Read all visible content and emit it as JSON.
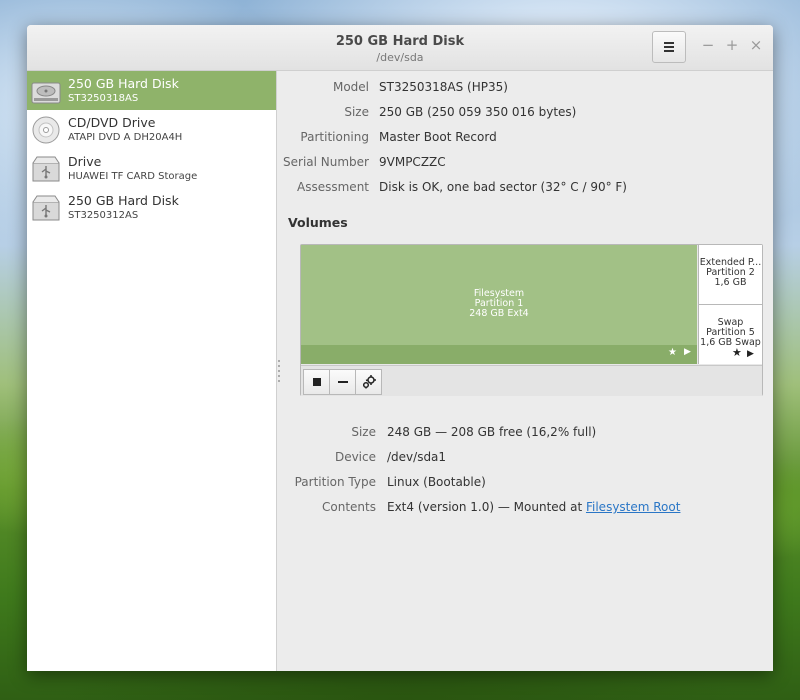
{
  "window": {
    "title": "250 GB Hard Disk",
    "subtitle": "/dev/sda"
  },
  "window_controls": {
    "minimize": "−",
    "maximize": "+",
    "close": "×"
  },
  "drives": [
    {
      "name": "250 GB Hard Disk",
      "detail": "ST3250318AS",
      "icon": "hard-disk-icon",
      "selected": true
    },
    {
      "name": "CD/DVD Drive",
      "detail": "ATAPI   DVD A  DH20A4H",
      "icon": "optical-disc-icon",
      "selected": false
    },
    {
      "name": "Drive",
      "detail": "HUAWEI TF CARD Storage",
      "icon": "usb-drive-icon",
      "selected": false
    },
    {
      "name": "250 GB Hard Disk",
      "detail": "ST3250312AS",
      "icon": "usb-drive-icon",
      "selected": false
    }
  ],
  "disk": {
    "model_label": "Model",
    "model": "ST3250318AS (HP35)",
    "size_label": "Size",
    "size": "250 GB (250 059 350 016 bytes)",
    "partitioning_label": "Partitioning",
    "partitioning": "Master Boot Record",
    "serial_label": "Serial Number",
    "serial": "9VMPCZZC",
    "assessment_label": "Assessment",
    "assessment": "Disk is OK, one bad sector (32° C / 90° F)"
  },
  "volumes": {
    "title": "Volumes",
    "main": {
      "line1": "Filesystem",
      "line2": "Partition 1",
      "line3": "248 GB Ext4"
    },
    "extended": {
      "line1": "Extended P...",
      "line2": "Partition 2",
      "line3": "1,6 GB"
    },
    "swap": {
      "line1": "Swap",
      "line2": "Partition 5",
      "line3": "1,6 GB Swap"
    }
  },
  "volume_details": {
    "size_label": "Size",
    "size": "248 GB — 208 GB free (16,2% full)",
    "device_label": "Device",
    "device": "/dev/sda1",
    "type_label": "Partition Type",
    "type": "Linux (Bootable)",
    "contents_label": "Contents",
    "contents_prefix": "Ext4 (version 1.0) — Mounted at ",
    "contents_link": "Filesystem Root"
  },
  "colors": {
    "selection": "#8fb36a",
    "volume": "#a2c186",
    "link": "#2a76c6"
  }
}
